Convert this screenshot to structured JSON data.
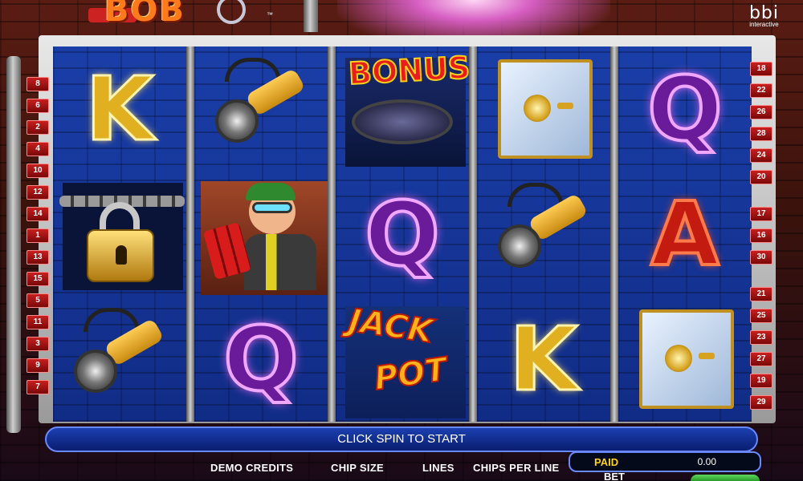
{
  "logo": {
    "text": "BOB",
    "tm": "™"
  },
  "brand": {
    "name": "bbi",
    "sub": "interactive"
  },
  "reels": [
    [
      "K",
      "lock",
      "torch"
    ],
    [
      "torch",
      "bob",
      "Q"
    ],
    [
      "bonus",
      "Q",
      "jackpot"
    ],
    [
      "safe",
      "torch",
      "K"
    ],
    [
      "Q",
      "A",
      "safe"
    ]
  ],
  "symbols": {
    "bonus": "BONUS",
    "jack": "JACK",
    "pot": "POT"
  },
  "paylines_left": [
    "8",
    "6",
    "2",
    "4",
    "10",
    "12",
    "14",
    "1",
    "13",
    "15",
    "5",
    "11",
    "3",
    "9",
    "7"
  ],
  "paylines_right": [
    "18",
    "22",
    "26",
    "28",
    "24",
    "20",
    "17",
    "16",
    "30",
    "21",
    "25",
    "23",
    "27",
    "19",
    "29"
  ],
  "message": "CLICK SPIN TO START",
  "controls": {
    "demo_credits": "DEMO CREDITS",
    "chip_size": "CHIP SIZE",
    "lines": "LINES",
    "chips_per_line": "CHIPS PER LINE",
    "paid_label": "PAID",
    "paid_value": "0.00",
    "bet_label": "BET"
  },
  "colors": {
    "reel_blue": "#1a3ea8",
    "payline_red": "#c81f1f",
    "paid_yellow": "#ffd21a"
  }
}
